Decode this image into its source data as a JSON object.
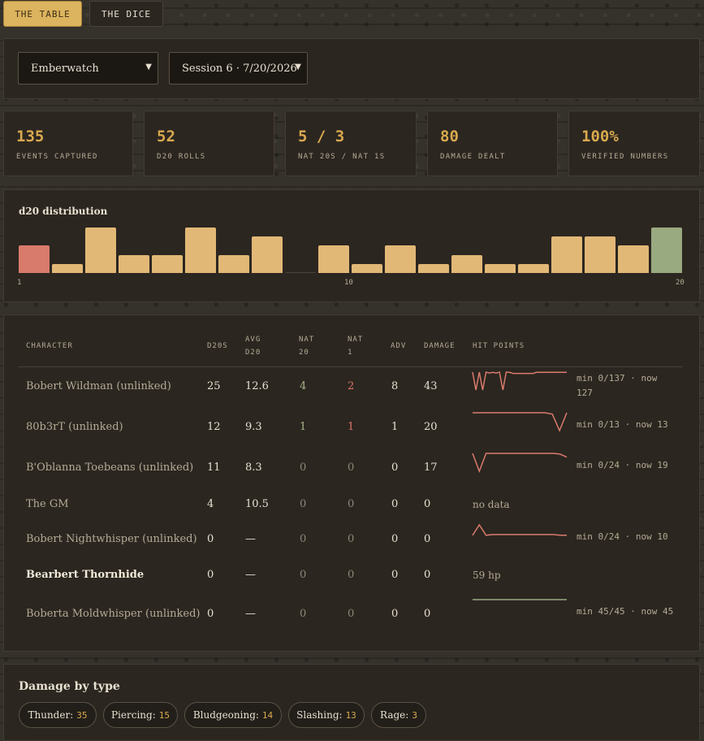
{
  "tabs": [
    {
      "label": "THE TABLE",
      "active": true
    },
    {
      "label": "THE DICE",
      "active": false
    }
  ],
  "campaign_select": {
    "value": "Emberwatch"
  },
  "session_select": {
    "value": "Session 6 · 7/20/2026"
  },
  "stats": [
    {
      "value": "135",
      "label": "EVENTS CAPTURED"
    },
    {
      "value": "52",
      "label": "D20 ROLLS"
    },
    {
      "value": "5 / 3",
      "label": "NAT 20S / NAT 1S"
    },
    {
      "value": "80",
      "label": "DAMAGE DEALT"
    },
    {
      "value": "100%",
      "label": "VERIFIED NUMBERS"
    }
  ],
  "chart_data": {
    "type": "bar",
    "title": "d20 distribution",
    "categories": [
      1,
      2,
      3,
      4,
      5,
      6,
      7,
      8,
      9,
      10,
      11,
      12,
      13,
      14,
      15,
      16,
      17,
      18,
      19,
      20
    ],
    "values": [
      3,
      1,
      5,
      2,
      2,
      5,
      2,
      4,
      0,
      3,
      1,
      3,
      1,
      2,
      1,
      1,
      4,
      4,
      3,
      5
    ],
    "tick_labels": [
      "1",
      "10",
      "20"
    ],
    "colors": {
      "nat1": "#d97b6c",
      "normal": "#e2b877",
      "nat20": "#9aaa80"
    }
  },
  "table": {
    "headers": {
      "character": "CHARACTER",
      "d20s": "D20S",
      "avg": "AVG D20",
      "nat20": "NAT 20",
      "nat1": "NAT 1",
      "adv": "ADV",
      "damage": "DAMAGE",
      "hp": "HIT POINTS"
    },
    "rows": [
      {
        "name": "Bobert Wildman (unlinked)",
        "d20s": "25",
        "avg": "12.6",
        "nat20": "4",
        "nat1": "2",
        "adv": "8",
        "damage": "43",
        "hp_note": "min 0/137 · now 127",
        "hp_series": [
          137,
          0,
          137,
          0,
          137,
          130,
          135,
          130,
          137,
          0,
          137,
          135,
          127,
          127,
          127,
          127,
          127,
          127,
          127,
          135,
          135,
          135,
          135,
          135,
          135,
          135,
          135,
          135,
          135
        ],
        "hp_max": 137
      },
      {
        "name": "80b3rT (unlinked)",
        "d20s": "12",
        "avg": "9.3",
        "nat20": "1",
        "nat1": "1",
        "adv": "1",
        "damage": "20",
        "hp_note": "min 0/13 · now 13",
        "hp_series": [
          13,
          13,
          13,
          13,
          13,
          13,
          13,
          13,
          13,
          13,
          13,
          12,
          0,
          13
        ],
        "hp_max": 13
      },
      {
        "name": "B'Oblanna Toebeans (unlinked)",
        "d20s": "11",
        "avg": "8.3",
        "nat20": "0",
        "nat1": "0",
        "adv": "0",
        "damage": "17",
        "hp_note": "min 0/24 · now 19",
        "hp_series": [
          24,
          0,
          24,
          24,
          24,
          24,
          24,
          24,
          24,
          24,
          24,
          24,
          24,
          23,
          19
        ],
        "hp_max": 24
      },
      {
        "name": "The GM",
        "d20s": "4",
        "avg": "10.5",
        "nat20": "0",
        "nat1": "0",
        "adv": "0",
        "damage": "0",
        "hp_plain": "no data"
      },
      {
        "name": "Bobert Nightwhisper (unlinked)",
        "d20s": "0",
        "avg": "—",
        "nat20": "0",
        "nat1": "0",
        "adv": "0",
        "damage": "0",
        "hp_note": "min 0/24 · now 10",
        "hp_series": [
          10,
          24,
          10,
          11,
          11,
          11,
          11,
          11,
          11,
          11,
          11,
          11,
          11,
          10,
          10
        ],
        "hp_max": 24
      },
      {
        "name": "Bearbert Thornhide",
        "bold": true,
        "d20s": "0",
        "avg": "—",
        "nat20": "0",
        "nat1": "0",
        "adv": "0",
        "damage": "0",
        "hp_plain": "59 hp"
      },
      {
        "name": "Boberta Moldwhisper (unlinked)",
        "d20s": "0",
        "avg": "—",
        "nat20": "0",
        "nat1": "0",
        "adv": "0",
        "damage": "0",
        "hp_note": "min 45/45 · now 45",
        "hp_series": [
          45,
          45,
          45,
          45,
          45
        ],
        "hp_max": 45,
        "hp_color": "#9aaa80"
      }
    ]
  },
  "damage": {
    "title": "Damage by type",
    "chips": [
      {
        "type": "Thunder:",
        "value": "35"
      },
      {
        "type": "Piercing:",
        "value": "15"
      },
      {
        "type": "Bludgeoning:",
        "value": "14"
      },
      {
        "type": "Slashing:",
        "value": "13"
      },
      {
        "type": "Rage:",
        "value": "3"
      }
    ]
  },
  "colors": {
    "accent": "#dcb35e",
    "hp_line": "#d97b6c",
    "panel": "#2b2620"
  }
}
